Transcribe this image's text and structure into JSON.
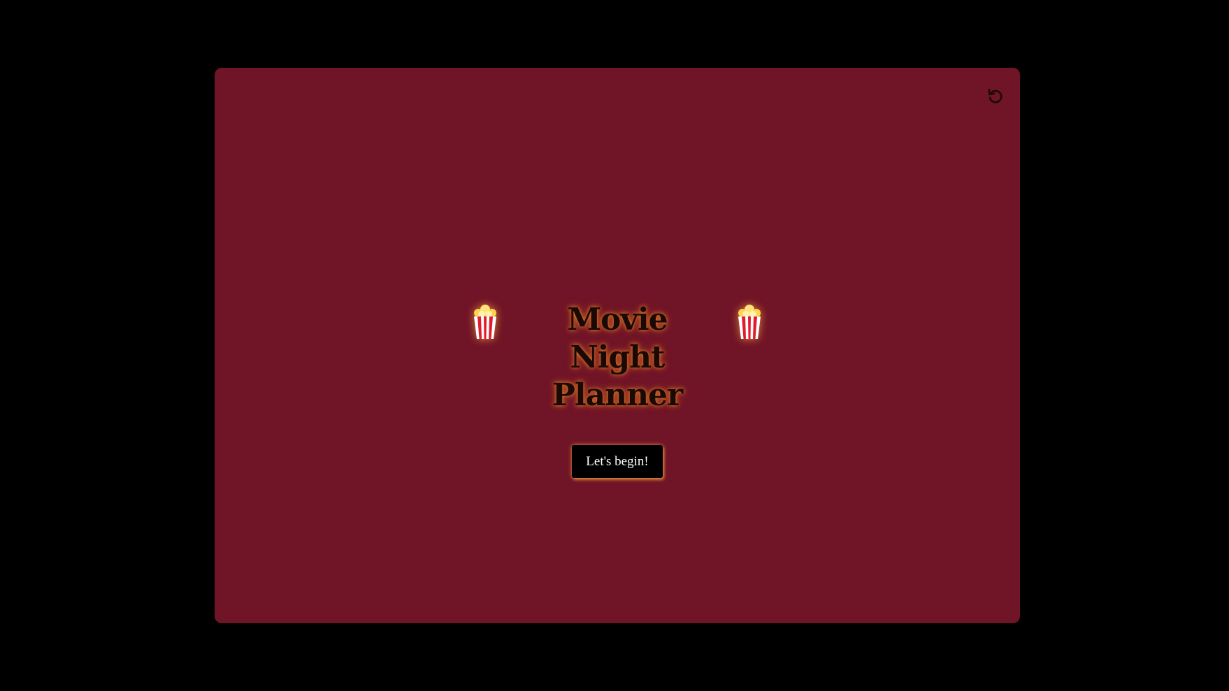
{
  "page": {
    "title_line1": "Movie Night",
    "title_line2": "Planner",
    "begin_button_label": "Let's begin!"
  },
  "icons": {
    "left_decoration": "popcorn-icon",
    "right_decoration": "popcorn-icon",
    "reset": "reset-icon"
  },
  "colors": {
    "background": "#000000",
    "card": "#701427",
    "title_text": "#1a0a06",
    "title_glow": "#ff9628",
    "button_background": "#000000",
    "button_text": "#ffffff",
    "button_glow": "#ffaa3c"
  }
}
